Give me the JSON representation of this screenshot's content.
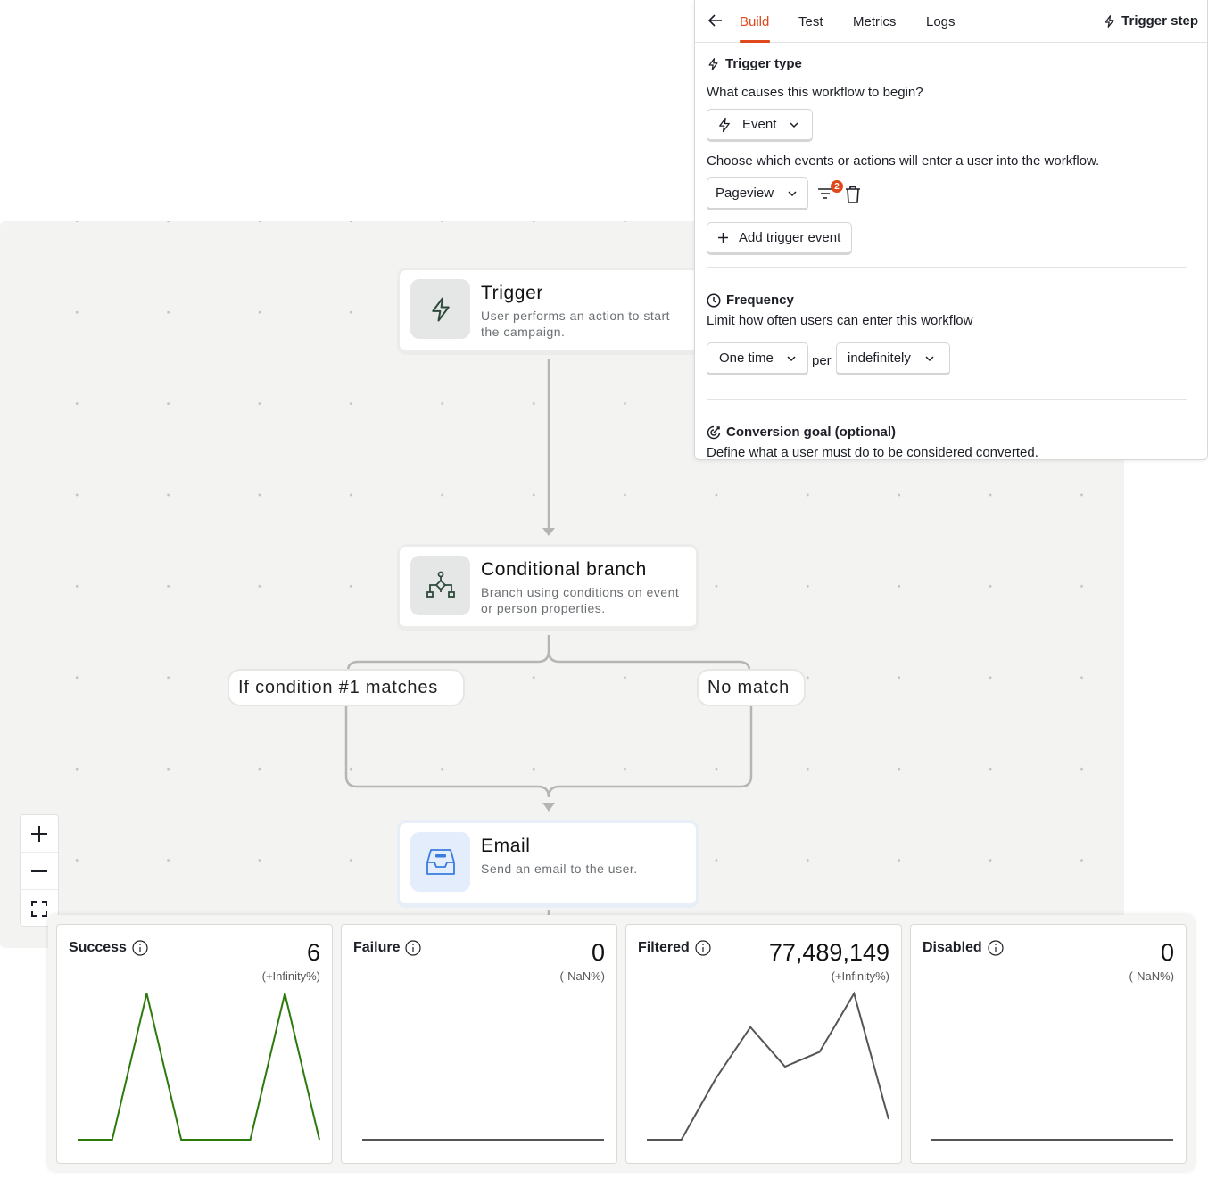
{
  "canvas": {
    "nodes": {
      "trigger": {
        "title": "Trigger",
        "description": "User performs an action to start the campaign.",
        "icon": "lightning-icon"
      },
      "conditional": {
        "title": "Conditional branch",
        "description": "Branch using conditions on event or person properties.",
        "icon": "branch-icon"
      },
      "email": {
        "title": "Email",
        "description": "Send an email to the user.",
        "icon": "inbox-icon"
      }
    },
    "branches": {
      "left": "If condition #1 matches",
      "right": "No match"
    },
    "zoom": {
      "icons": [
        "plus-icon",
        "minus-icon",
        "fit-view-icon"
      ]
    }
  },
  "panel": {
    "tabs": [
      "Build",
      "Test",
      "Metrics",
      "Logs"
    ],
    "active_tab": "Build",
    "step_label": "Trigger step",
    "trigger_type": {
      "title": "Trigger type",
      "question": "What causes this workflow to begin?",
      "type_value": "Event",
      "events_help": "Choose which events or actions will enter a user into the workflow.",
      "event_value": "Pageview",
      "filter_count": "2",
      "add_label": "Add trigger event"
    },
    "frequency": {
      "title": "Frequency",
      "description": "Limit how often users can enter this workflow",
      "count_value": "One time",
      "per_label": "per",
      "period_value": "indefinitely"
    },
    "conversion": {
      "title": "Conversion goal (optional)",
      "description": "Define what a user must do to be considered converted."
    }
  },
  "metrics": [
    {
      "label": "Success",
      "value": "6",
      "change": "(+Infinity%)",
      "color": "#2b7a0b",
      "series": [
        0,
        0,
        1,
        0,
        0,
        0,
        1,
        0
      ]
    },
    {
      "label": "Failure",
      "value": "0",
      "change": "(-NaN%)",
      "color": "#555555",
      "series": [
        0,
        0,
        0,
        0,
        0,
        0,
        0,
        0
      ]
    },
    {
      "label": "Filtered",
      "value": "77,489,149",
      "change": "(+Infinity%)",
      "color": "#555555",
      "series": [
        0,
        0,
        0.42,
        0.77,
        0.5,
        0.6,
        1,
        0.14
      ]
    },
    {
      "label": "Disabled",
      "value": "0",
      "change": "(-NaN%)",
      "color": "#555555",
      "series": [
        0,
        0,
        0,
        0,
        0,
        0,
        0,
        0
      ]
    }
  ]
}
